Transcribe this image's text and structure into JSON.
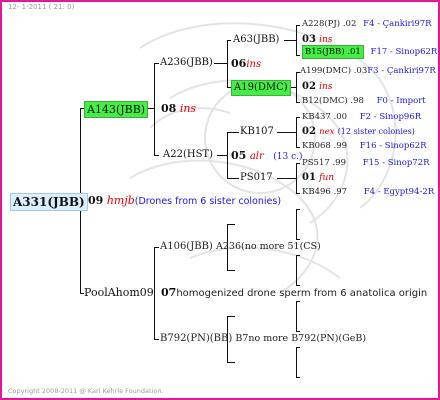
{
  "header": {
    "text": "12-  1-2011 ( 21:  0)"
  },
  "footer": {
    "text": "Copyright 2008-2011 @ Karl Kehrle Foundation."
  },
  "root": {
    "name": "A331(JBB)",
    "num": "09",
    "code": "hmjb",
    "note": "(Drones from 6 sister colonies)"
  },
  "gen1": {
    "top": {
      "name": "A143(JBB)",
      "num": "08",
      "code": "ins"
    },
    "bottom": {
      "name": "PoolAhom09",
      "num": "07",
      "note": "homogenized drone sperm from 6 anatolica origin"
    }
  },
  "gen2": {
    "a236": {
      "name": "A236(JBB)",
      "num": "06",
      "code": "ins"
    },
    "a22": {
      "name": "A22(HST)",
      "num": "05",
      "code": "alr",
      "note": "(13 c.)"
    },
    "a106": {
      "name": "A106(JBB)",
      "extra": "A236(no more 51(CS)"
    },
    "b792": {
      "name": "B792(PN)(BB)",
      "extra": "B7no more B792(PN)(GeB)"
    }
  },
  "gen3": {
    "a63": {
      "name": "A63(JBB)"
    },
    "a19": {
      "name": "A19(DMC)"
    },
    "kb107": {
      "name": "KB107"
    },
    "ps017": {
      "name": "PS017"
    }
  },
  "gen4": [
    {
      "name": "A228(PJ)",
      "val": ".02",
      "origin": "F4 - Çankiri97R"
    },
    {
      "num": "03",
      "code": "ins"
    },
    {
      "name": "B15(JBB)",
      "val": ".01",
      "origin": "F17 - Sinop62R"
    },
    {
      "name": "A199(DMC)",
      "val": ".03",
      "origin": "F3 - Çankiri97R"
    },
    {
      "num": "02",
      "code": "ins"
    },
    {
      "name": "B12(DMC)",
      "val": ".98",
      "origin": "F0 - Import"
    },
    {
      "name": "KB437",
      "val": ".00",
      "origin": "F2 - Sinop96R"
    },
    {
      "num": "02",
      "code": "nex",
      "note": "(12 sister colonies)"
    },
    {
      "name": "KB068",
      "val": ".99",
      "origin": "F16 - Sinop62R"
    },
    {
      "name": "PS517",
      "val": ".99",
      "origin": "F15 - Sinop72R"
    },
    {
      "num": "01",
      "code": "fun"
    },
    {
      "name": "KB496",
      "val": ".97",
      "origin": "F4 - Egypt94-2R"
    }
  ]
}
